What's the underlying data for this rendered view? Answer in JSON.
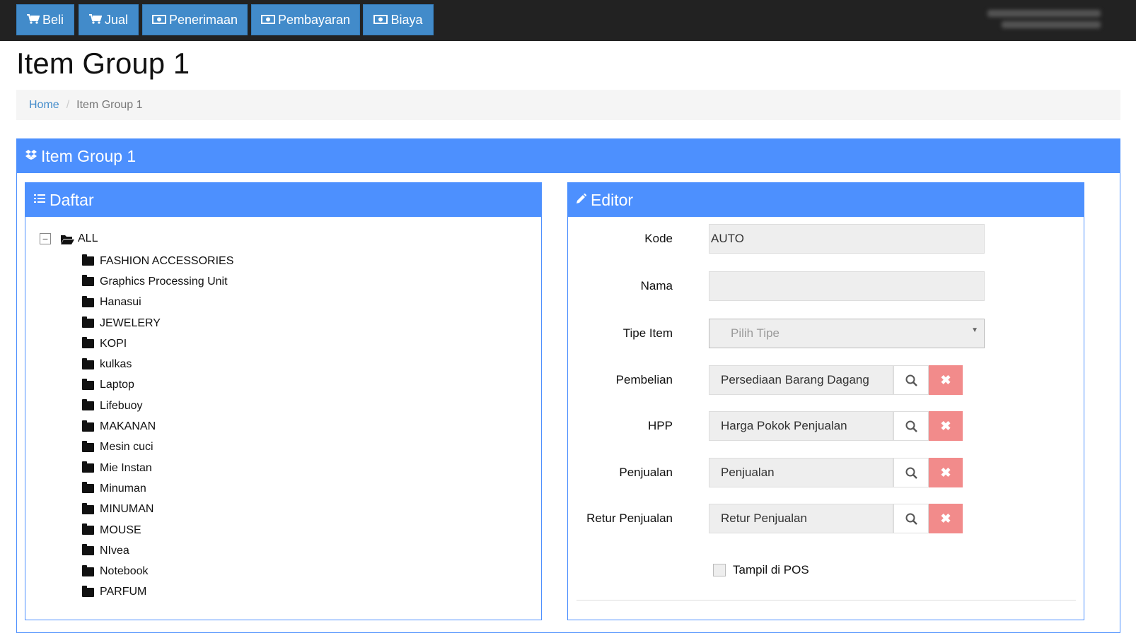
{
  "topnav": {
    "buttons": [
      {
        "label": "Beli",
        "icon": "cart-icon"
      },
      {
        "label": "Jual",
        "icon": "cart-icon"
      },
      {
        "label": "Penerimaan",
        "icon": "money-icon"
      },
      {
        "label": "Pembayaran",
        "icon": "money-icon"
      },
      {
        "label": "Biaya",
        "icon": "money-icon"
      }
    ],
    "user_line1": "",
    "user_line2": ""
  },
  "page": {
    "title": "Item Group 1"
  },
  "breadcrumb": {
    "home": "Home",
    "separator": "/",
    "current": "Item Group 1"
  },
  "main_panel": {
    "title": "Item Group 1",
    "icon": "dropbox-icon"
  },
  "daftar": {
    "title": "Daftar",
    "icon": "list-icon",
    "root": {
      "toggle": "−",
      "label": "ALL"
    },
    "items": [
      "FASHION ACCESSORIES",
      "Graphics Processing Unit",
      "Hanasui",
      "JEWELERY",
      "KOPI",
      "kulkas",
      "Laptop",
      "Lifebuoy",
      "MAKANAN",
      "Mesin cuci",
      "Mie Instan",
      "Minuman",
      "MINUMAN",
      "MOUSE",
      "NIvea",
      "Notebook",
      "PARFUM"
    ]
  },
  "editor": {
    "title": "Editor",
    "icon": "pencil-icon",
    "kode": {
      "label": "Kode",
      "value": "AUTO"
    },
    "nama": {
      "label": "Nama",
      "value": ""
    },
    "tipe_item": {
      "label": "Tipe Item",
      "placeholder": "Pilih Tipe"
    },
    "pembelian": {
      "label": "Pembelian",
      "value": "Persediaan Barang Dagang"
    },
    "hpp": {
      "label": "HPP",
      "value": "Harga Pokok Penjualan"
    },
    "penjualan": {
      "label": "Penjualan",
      "value": "Penjualan"
    },
    "retur_penjualan": {
      "label": "Retur Penjualan",
      "value": "Retur Penjualan"
    },
    "tampil_pos": {
      "label": "Tampil di POS",
      "checked": false
    },
    "clear_glyph": "✖"
  },
  "colors": {
    "topbar": "#222222",
    "nav_button": "#428bca",
    "panel_header": "#4d90fe",
    "clear_button": "#f28b8b",
    "input_bg": "#eeeeee"
  }
}
